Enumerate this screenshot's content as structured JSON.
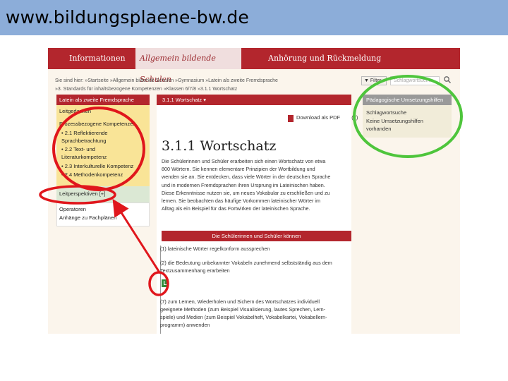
{
  "slide": {
    "url": "www.bildungsplaene-bw.de"
  },
  "topnav": {
    "items": [
      "Informationen",
      "Allgemein bildende Schulen",
      "Anhörung und Rückmeldung"
    ]
  },
  "breadcrumb": {
    "line1": "Sie sind hier:  »Startseite  »Allgemein bildende Schulen  »Gymnasium  »Latein als zweite Fremdsprache",
    "line2": "»3. Standards für inhaltsbezogene Kompetenzen  »Klassen 6/7/8  »3.1.1 Wortschatz"
  },
  "toolbar": {
    "filter_label": "Filter",
    "search_placeholder": "Schlagwortsuche"
  },
  "leftnav": {
    "header": "Latein als zweite Fremdsprache",
    "leitgedanken": "Leitgedanken",
    "prozess_title": "Prozessbezogene Kompetenzen",
    "items": [
      "• 2.1 Reflektierende",
      "  Sprachbetrachtung",
      "• 2.2 Text- und",
      "  Literaturkompetenz",
      "• 2.3 Interkulturelle Kompetenz",
      "• 2.4 Methodenkompetenz"
    ],
    "leitperspektiven": "Leitperspektiven [+]",
    "operatoren": "Operatoren",
    "anhaenge": "Anhänge zu Fachplänen"
  },
  "content": {
    "tab_label": "3.1.1 Wortschatz  ▾",
    "download_label": "Download als PDF",
    "download_suffix": "(7)",
    "title": "3.1.1 Wortschatz",
    "lines": [
      "Die Schülerinnen und Schüler erarbeiten sich einen Wortschatz von etwa",
      "800 Wörtern. Sie kennen elementare Prinzipien der Wortbildung und",
      "wenden sie an. Sie entdecken, dass viele Wörter in der deutschen Sprache",
      "und in modernen Fremdsprachen ihren Ursprung im Lateinischen haben.",
      "Diese Erkenntnisse nutzen sie, um neues Vokabular zu erschließen und zu",
      "lernen. Sie beobachten das häufige Vorkommen lateinischer Wörter im",
      "Alltag als ein Beispiel für das Fortwirken der lateinischen Sprache."
    ],
    "band_label": "Die Schülerinnen und Schüler können",
    "item1": "(1)  lateinische Wörter regelkonform aussprechen",
    "item2a": "(2)  die Bedeutung unbekannter Vokabeln zunehmend selbstständig aus dem",
    "item2b": "       Textzusammenhang erarbeiten",
    "badge": "L",
    "item3a": "(7)  zum Lernen, Wiederholen und Sichern des Wortschatzes individuell",
    "item3b": "       geeignete Methoden (zum Beispiel Visualisierung, lautes Sprechen, Lern-",
    "item3c": "       spiele) und Medien (zum Beispiel Vokabelheft, Vokabelkartei, Vokabellern-",
    "item3d": "       programm) anwenden"
  },
  "rightpanel": {
    "header": "Pädagogische Umsetzungshilfen",
    "label": "Schlagwortsuche",
    "text1": "Keine Umsetzungshilfen",
    "text2": "vorhanden"
  },
  "annotation_colors": {
    "red": "#e0161c",
    "green": "#4ec53c"
  }
}
